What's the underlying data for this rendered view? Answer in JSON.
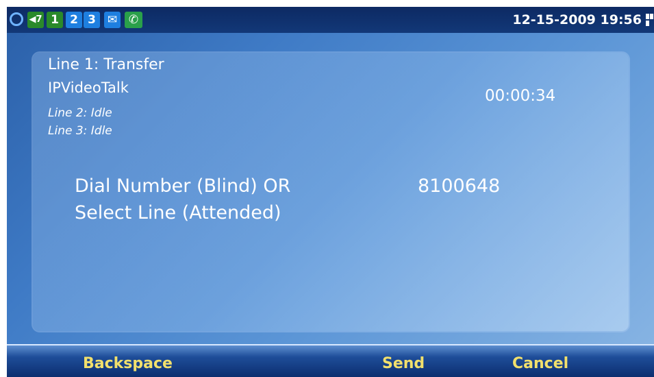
{
  "status_bar": {
    "icons": [
      {
        "name": "network-status-icon",
        "color": "#6fb3ff"
      },
      {
        "name": "volume-icon",
        "glyph": "◀7",
        "color": "#2a8a2a"
      },
      {
        "name": "line-1-indicator",
        "glyph": "1",
        "color": "#2a8a2a"
      },
      {
        "name": "line-2-indicator",
        "glyph": "2",
        "color": "#1e7fe0"
      },
      {
        "name": "line-3-indicator",
        "glyph": "3",
        "color": "#1e7fe0"
      },
      {
        "name": "message-icon",
        "glyph": "✉",
        "color": "#1e7fe0"
      },
      {
        "name": "phone-icon",
        "glyph": "✆",
        "color": "#2aa04a"
      }
    ],
    "datetime": "12-15-2009 19:56"
  },
  "call": {
    "line1_status": "Line 1: Transfer",
    "caller_name": "IPVideoTalk",
    "line2_status": "Line 2: Idle",
    "line3_status": "Line 3: Idle",
    "timer": "00:00:34"
  },
  "transfer": {
    "prompt_line1": "Dial Number (Blind) OR",
    "prompt_line2": "Select Line (Attended)",
    "dialed_number": "8100648"
  },
  "softkeys": {
    "backspace": "Backspace",
    "send": "Send",
    "cancel": "Cancel"
  },
  "colors": {
    "softkey_text": "#f2e06c",
    "status_bar_bg": "#0d2a63",
    "screen_bg": "#3f7bc6"
  }
}
